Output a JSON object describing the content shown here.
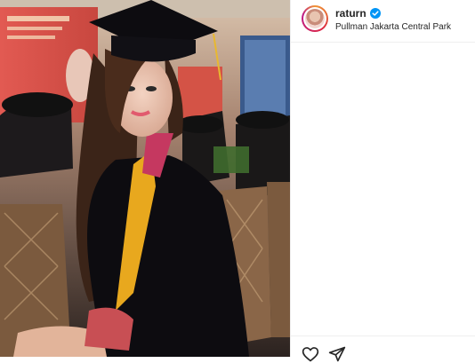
{
  "post": {
    "username": "raturn",
    "location": "Pullman Jakarta Central Park",
    "verified": true
  },
  "icons": {
    "like": "heart-icon",
    "share": "paper-plane-icon",
    "verified": "verified-badge-icon"
  },
  "colors": {
    "verified": "#0095f6",
    "border": "#efefef",
    "text": "#262626"
  }
}
